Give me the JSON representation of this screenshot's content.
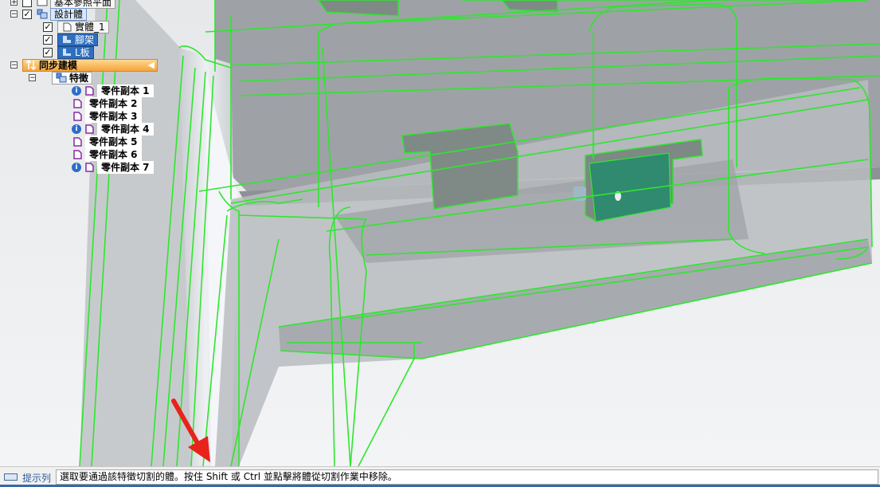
{
  "tree": {
    "items": [
      {
        "label": "基本參照平面",
        "checked": false,
        "expander": "+"
      },
      {
        "label": "設計體",
        "checked": true,
        "expander": "−"
      },
      {
        "label": "實體_1",
        "checked": true
      },
      {
        "label": "腳架",
        "checked": true
      },
      {
        "label": "L板",
        "checked": true
      },
      {
        "label": "同步建模",
        "expander": "−"
      },
      {
        "label": "特徵",
        "expander": "−"
      }
    ],
    "features": [
      {
        "label": "零件副本 1",
        "info": true
      },
      {
        "label": "零件副本 2",
        "info": false
      },
      {
        "label": "零件副本 3",
        "info": false
      },
      {
        "label": "零件副本 4",
        "info": true
      },
      {
        "label": "零件副本 5",
        "info": false
      },
      {
        "label": "零件副本 6",
        "info": false
      },
      {
        "label": "零件副本 7",
        "info": true
      }
    ]
  },
  "statusbar": {
    "title": "提示列",
    "message": "選取要通過該特徵切割的體。按住 Shift 或 Ctrl 並點擊將體從切割作業中移除。"
  },
  "colors": {
    "highlight_edge": "#2ee62e",
    "annotation_arrow": "#e8231c",
    "status_accent": "#3a67a8"
  },
  "icons": [
    "keyboard-icon",
    "info-icon",
    "part-icon",
    "body-icon",
    "sync-icon",
    "feature-icon"
  ]
}
